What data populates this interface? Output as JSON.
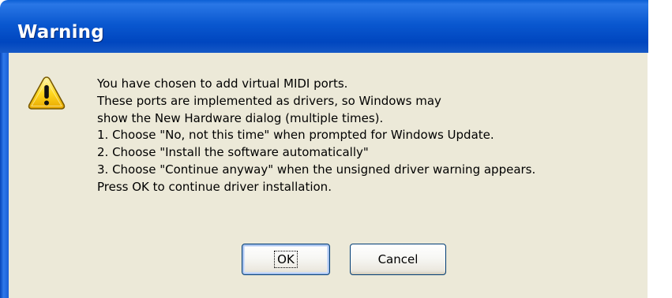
{
  "dialog": {
    "title": "Warning",
    "icon": "warning-icon",
    "message_lines": [
      "You have chosen to add virtual MIDI ports.",
      "These ports are implemented as drivers, so Windows may",
      "show the New Hardware dialog (multiple times).",
      "1. Choose \"No, not this time\" when prompted for Windows Update.",
      "2. Choose \"Install the software automatically\"",
      "3. Choose \"Continue anyway\" when the unsigned driver warning appears.",
      "Press OK to continue driver installation."
    ],
    "buttons": {
      "ok_label": "OK",
      "cancel_label": "Cancel"
    }
  },
  "colors": {
    "titlebar": "#0a58d0",
    "client_background": "#ece9d8",
    "icon_fill": "#ffd21e",
    "button_border": "#003c74"
  }
}
